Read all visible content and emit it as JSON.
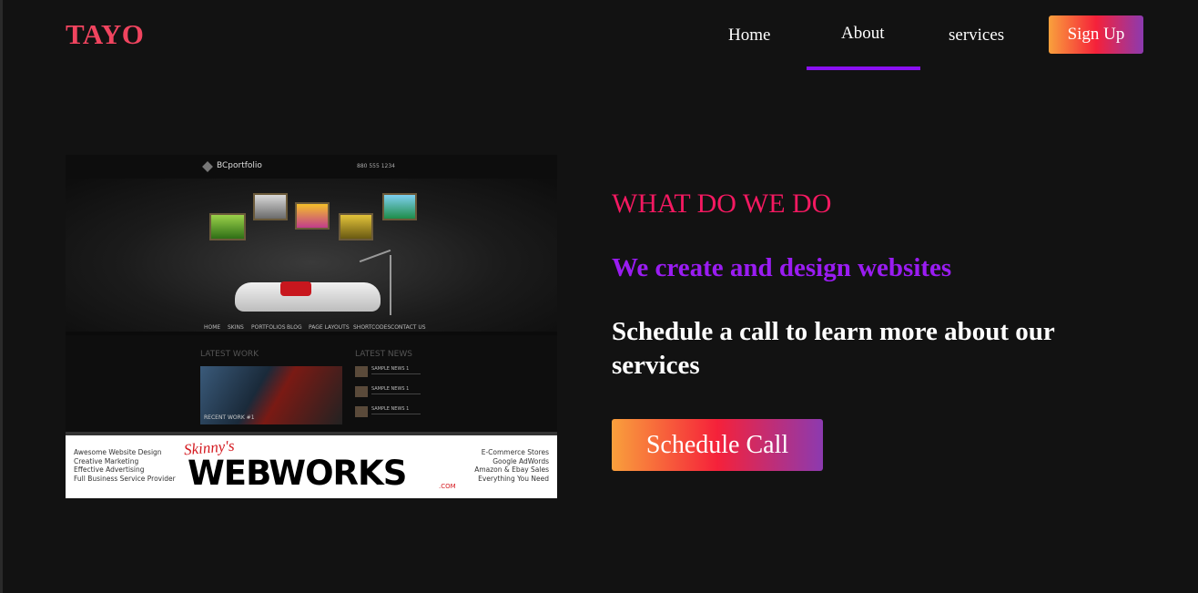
{
  "header": {
    "brand": "TAYO",
    "nav": [
      {
        "label": "Home"
      },
      {
        "label": "About",
        "active": true
      },
      {
        "label": "services"
      }
    ],
    "signup_label": "Sign Up"
  },
  "colors": {
    "background": "#121212",
    "brand": "#f0445f",
    "accent_underline": "#8a10f2",
    "heading_pink": "#f41961",
    "heading_purple": "#9a1cf2",
    "button_gradient": [
      "#f9a03c",
      "#f5213a",
      "#8c3ab0"
    ]
  },
  "preview_image": {
    "site_logo": "BCportfolio",
    "phone": "880 555 1234",
    "menu": [
      "HOME",
      "SKINS",
      "PORTFOLIOS",
      "BLOG",
      "PAGE LAYOUTS",
      "SHORTCODES",
      "CONTACT US"
    ],
    "latest_work": "LATEST WORK",
    "latest_news": "LATEST NEWS",
    "recent_work_caption": "RECENT WORK #1",
    "news_items": [
      "SAMPLE NEWS 1",
      "SAMPLE NEWS 1",
      "SAMPLE NEWS 1"
    ],
    "banner": {
      "left_lines": [
        "Awesome Website Design",
        "Creative Marketing",
        "Effective Advertising",
        "Full Business Service Provider"
      ],
      "script": "Skinny's",
      "logo": "WEBWORKS",
      "com": ".COM",
      "right_lines": [
        "E-Commerce Stores",
        "Google AdWords",
        "Amazon & Ebay Sales",
        "Everything You Need"
      ]
    }
  },
  "main": {
    "heading": "WHAT DO WE DO",
    "subheading": "We create and design websites",
    "body": "Schedule a call to learn more about our services",
    "cta_label": "Schedule Call"
  }
}
